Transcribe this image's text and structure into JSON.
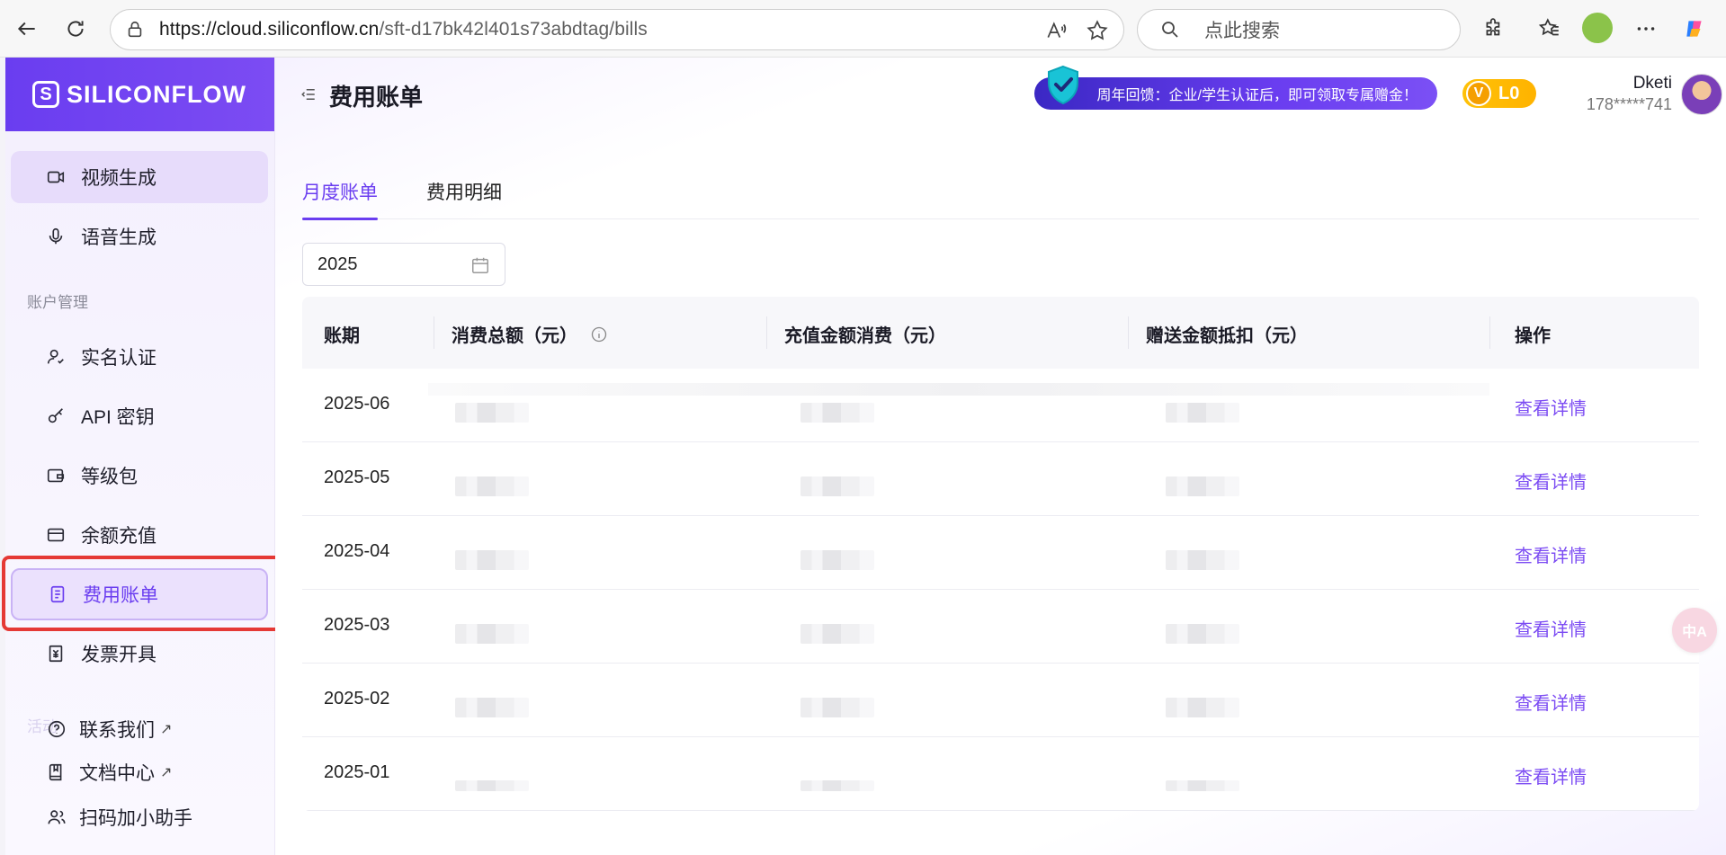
{
  "browser": {
    "url_host": "https://cloud.siliconflow.cn",
    "url_path": "/sft-d17bk42l401s73abdtag/bills",
    "search_placeholder": "点此搜索"
  },
  "brand": {
    "logo_letter": "S",
    "name": "SILICONFLOW",
    "accent": "#6a3df0"
  },
  "sidebar": {
    "items_top": [
      {
        "label": "视频生成",
        "icon": "video-icon"
      },
      {
        "label": "语音生成",
        "icon": "microphone-icon"
      }
    ],
    "section_account": "账户管理",
    "items_account": [
      {
        "label": "实名认证",
        "icon": "user-check-icon"
      },
      {
        "label": "API 密钥",
        "icon": "key-icon"
      },
      {
        "label": "等级包",
        "icon": "wallet-icon"
      },
      {
        "label": "余额充值",
        "icon": "card-icon"
      },
      {
        "label": "费用账单",
        "icon": "bill-icon"
      },
      {
        "label": "发票开具",
        "icon": "invoice-icon"
      }
    ],
    "faded_section": "活动",
    "items_bottom": [
      {
        "label": "联系我们",
        "icon": "help-circle-icon",
        "arrow": "↗"
      },
      {
        "label": "文档中心",
        "icon": "book-icon",
        "arrow": "↗"
      },
      {
        "label": "扫码加小助手",
        "icon": "users-icon"
      }
    ]
  },
  "header": {
    "title": "费用账单",
    "promo_text": "周年回馈：企业/学生认证后，即可领取专属赠金！",
    "level": "L0",
    "level_badge": "V",
    "user_name": "Dketi",
    "user_phone": "178*****741"
  },
  "tabs": [
    {
      "label": "月度账单",
      "active": true
    },
    {
      "label": "费用明细",
      "active": false
    }
  ],
  "filter": {
    "year": "2025"
  },
  "table": {
    "columns": [
      "账期",
      "消费总额（元）",
      "充值金额消费（元）",
      "赠送金额抵扣（元）",
      "操作"
    ],
    "rows": [
      {
        "period": "2025-06",
        "action": "查看详情"
      },
      {
        "period": "2025-05",
        "action": "查看详情"
      },
      {
        "period": "2025-04",
        "action": "查看详情"
      },
      {
        "period": "2025-03",
        "action": "查看详情"
      },
      {
        "period": "2025-02",
        "action": "查看详情"
      },
      {
        "period": "2025-01",
        "action": "查看详情"
      }
    ]
  },
  "translate_bubble": "中A"
}
